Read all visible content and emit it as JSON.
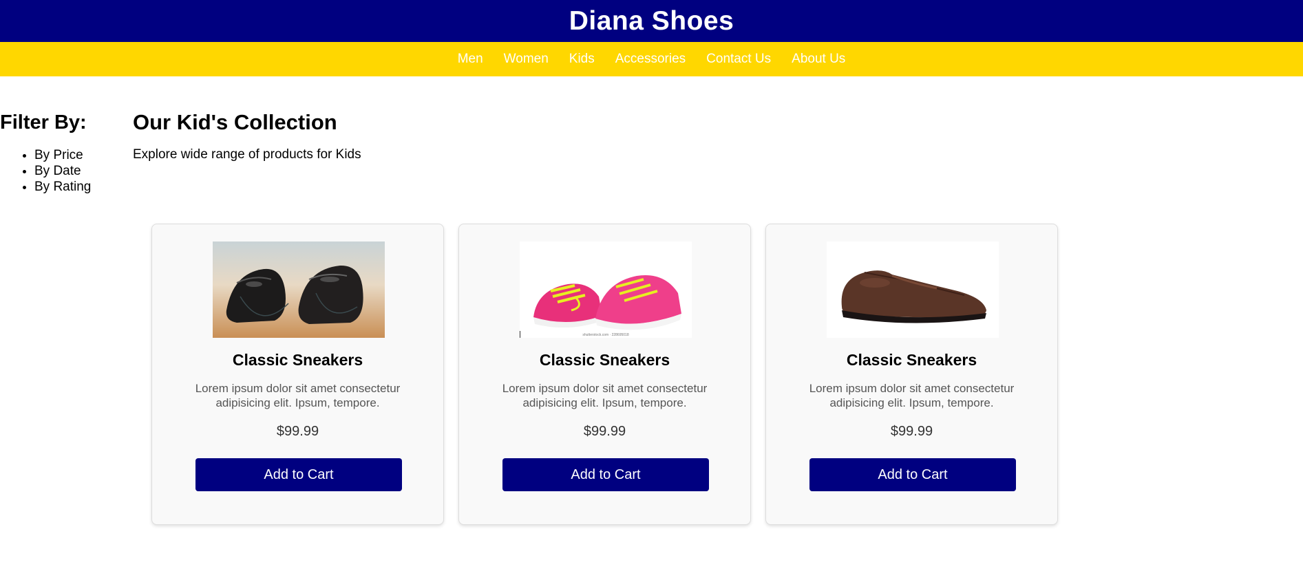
{
  "header": {
    "title": "Diana Shoes"
  },
  "nav": {
    "items": [
      "Men",
      "Women",
      "Kids",
      "Accessories",
      "Contact Us",
      "About Us"
    ]
  },
  "filter": {
    "heading": "Filter By:",
    "options": [
      "By Price",
      "By Date",
      "By Rating"
    ]
  },
  "main": {
    "title": "Our Kid's Collection",
    "subtitle": "Explore wide range of products for Kids"
  },
  "products": [
    {
      "image_icon": "black-leather-shoes-image",
      "name": "Classic Sneakers",
      "description": "Lorem ipsum dolor sit amet consectetur adipisicing elit. Ipsum, tempore.",
      "price": "$99.99",
      "button_label": "Add to Cart"
    },
    {
      "image_icon": "pink-sneakers-image",
      "name": "Classic Sneakers",
      "description": "Lorem ipsum dolor sit amet consectetur adipisicing elit. Ipsum, tempore.",
      "price": "$99.99",
      "button_label": "Add to Cart"
    },
    {
      "image_icon": "brown-loafer-image",
      "name": "Classic Sneakers",
      "description": "Lorem ipsum dolor sit amet consectetur adipisicing elit. Ipsum, tempore.",
      "price": "$99.99",
      "button_label": "Add to Cart"
    }
  ],
  "colors": {
    "header_bg": "#000080",
    "nav_bg": "#ffd700",
    "button_bg": "#000080",
    "card_bg": "#f9f9f9"
  }
}
